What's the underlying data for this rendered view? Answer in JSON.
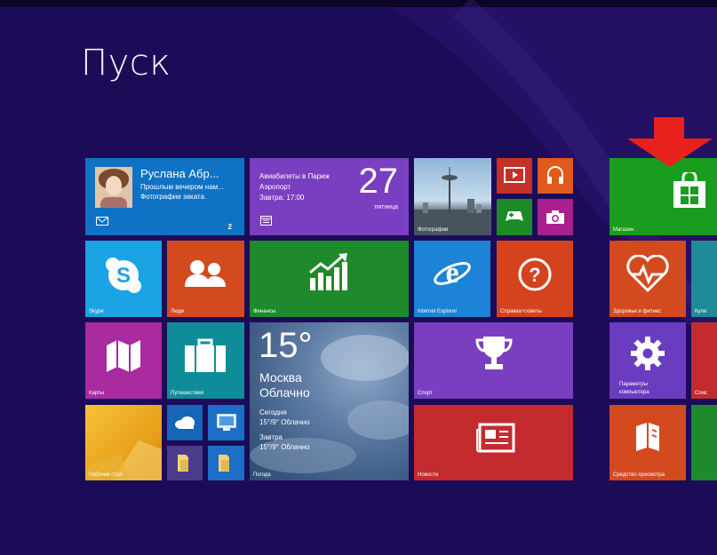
{
  "start": {
    "title": "Пуск"
  },
  "tiles": {
    "mail": {
      "name": "Руслана Абр...",
      "line1": "Прошлым вечером нам...",
      "line2": "Фотографии заката.",
      "count": "2"
    },
    "calendar": {
      "line1": "Авиабилеты в Париж",
      "line2": "Аэропорт",
      "line3": "Завтра: 17:00",
      "day": "27",
      "weekday": "пятница"
    },
    "photos": {
      "label": "Фотографии"
    },
    "skype": {
      "label": "Skype"
    },
    "people": {
      "label": "Люди"
    },
    "finance": {
      "label": "Финансы"
    },
    "ie": {
      "label": "Internet Explorer"
    },
    "help": {
      "label": "Справка+советы"
    },
    "maps": {
      "label": "Карты"
    },
    "travel": {
      "label": "Путешествия"
    },
    "weather": {
      "temp": "15°",
      "city": "Москва",
      "condition": "Облачно",
      "today_label": "Сегодня",
      "today_value": "15°/9° Облачно",
      "tomorrow_label": "Завтра",
      "tomorrow_value": "15°/9° Облачно",
      "label": "Погода"
    },
    "sport": {
      "label": "Спорт"
    },
    "news": {
      "label": "Новости"
    },
    "desktop": {
      "label": "Рабочий стол"
    },
    "store": {
      "label": "Магазин"
    },
    "health": {
      "label": "Здоровье и фитнес"
    },
    "kitchen": {
      "label": "Кули"
    },
    "settings": {
      "label": "Параметры",
      "label2": "компьютера"
    },
    "sleep": {
      "label": "Спис"
    },
    "reader": {
      "label": "Средство просмотра"
    }
  },
  "colors": {
    "background": "#1c0c57",
    "store_green": "#1a9c1e",
    "arrow_red": "#e8211c"
  }
}
